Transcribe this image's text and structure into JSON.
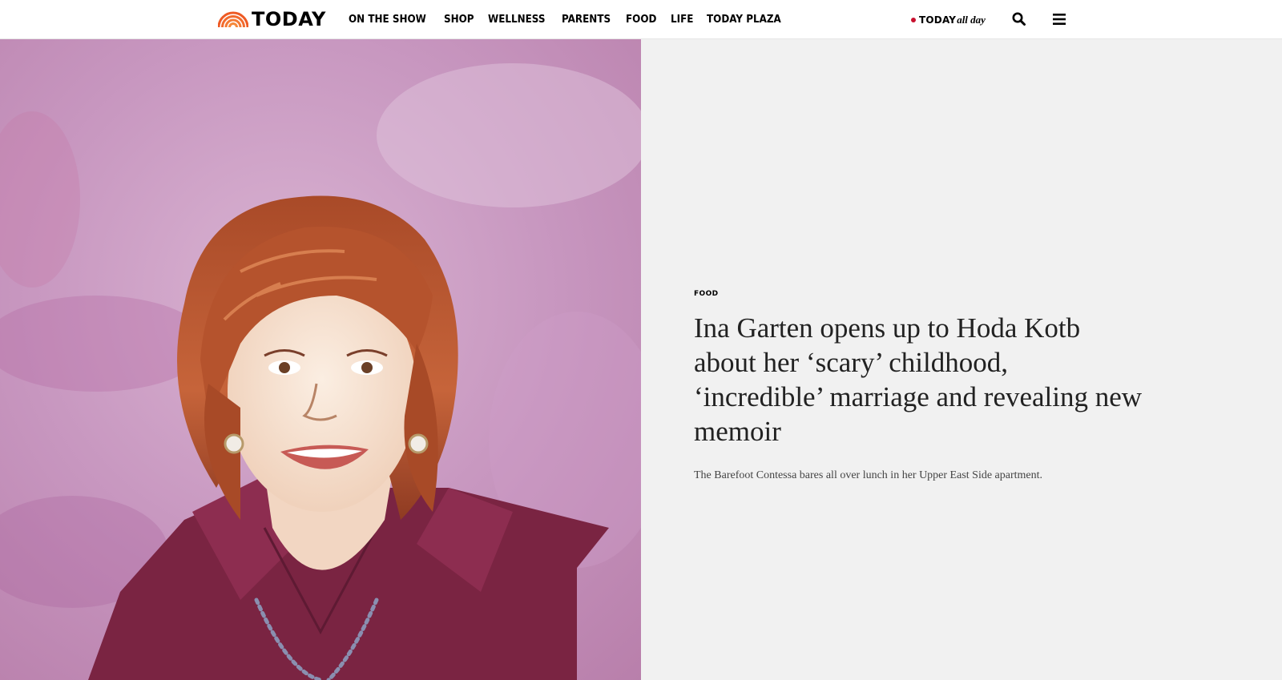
{
  "header": {
    "logo_text": "TODAY",
    "nav": [
      "ON THE SHOW",
      "SHOP",
      "WELLNESS",
      "PARENTS",
      "FOOD",
      "LIFE",
      "TODAY PLAZA"
    ],
    "allday_brand": "TODAY",
    "allday_suffix": "all day",
    "icons": {
      "search": "search-icon",
      "menu": "hamburger-menu-icon",
      "logo": "rainbow-logo-icon"
    }
  },
  "article": {
    "category": "FOOD",
    "headline": "Ina Garten opens up to Hoda Kotb about her ‘scary’ childhood, ‘incredible’ marriage and revealing new memoir",
    "dek": "The Barefoot Contessa bares all over lunch in her Upper East Side apartment."
  },
  "colors": {
    "brand_orange": "#ee5a24",
    "live_red": "#c8102e",
    "panel_bg": "#f1f1f1",
    "watercolor_bg": "#c9a0c4",
    "blouse": "#7a2442",
    "hair": "#b8562e"
  }
}
